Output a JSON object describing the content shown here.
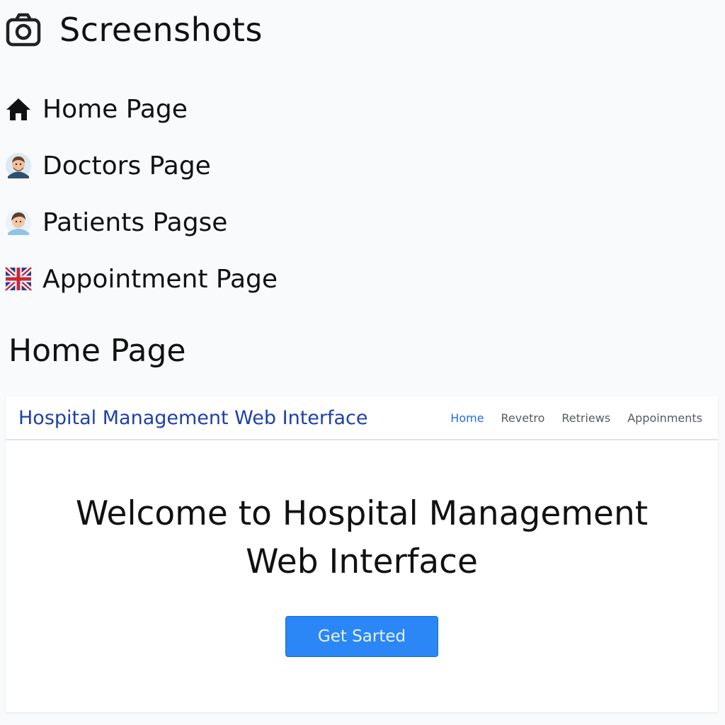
{
  "header": {
    "title": "Screenshots",
    "icon": "camera-icon"
  },
  "links": [
    {
      "label": "Home Page",
      "icon": "home-icon"
    },
    {
      "label": "Doctors Page",
      "icon": "doctor-avatar-icon"
    },
    {
      "label": "Patients Pagse",
      "icon": "patient-avatar-icon"
    },
    {
      "label": "Appointment Page",
      "icon": "uk-flag-icon"
    }
  ],
  "section": {
    "heading": "Home Page"
  },
  "screenshot": {
    "brand": "Hospital Management Web Interface",
    "nav": [
      "Home",
      "Revetro",
      "Retriews",
      "Appoinments"
    ],
    "active_nav": "Home",
    "hero_title": "Welcome to Hospital Management Web Interface",
    "cta_label": "Get Sarted"
  },
  "colors": {
    "brand": "#1e40a8",
    "active_nav": "#1f6fe6",
    "cta_background": "#2a87f5",
    "page_background": "#f9fafc"
  }
}
